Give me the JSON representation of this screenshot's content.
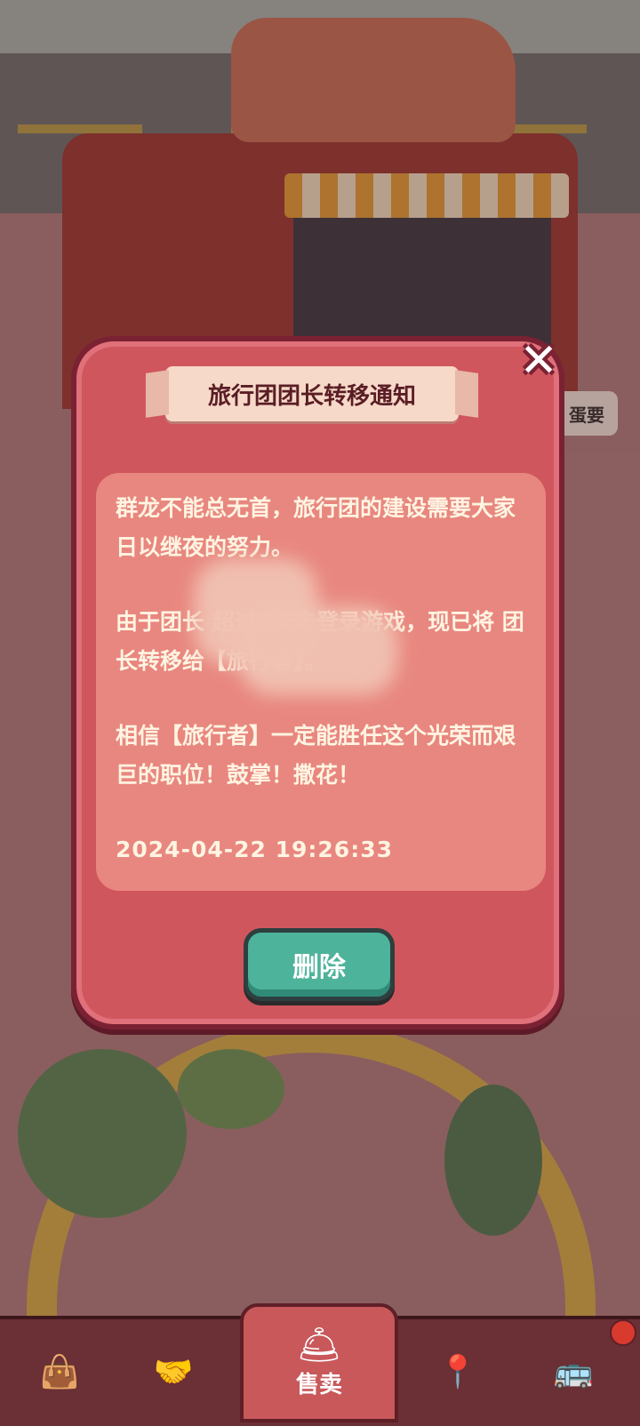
{
  "dialog": {
    "title": "旅行团团长转移通知",
    "paragraph1": "群龙不能总无首，旅行团的建设需要大家日以继夜的努力。",
    "paragraph2": "由于团长    超过7天未登录游戏，现已将     团长转移给【旅行者】。",
    "paragraph3": "相信【旅行者】一定能胜任这个光荣而艰巨的职位！鼓掌！撒花！",
    "timestamp": "2024-04-22 19:26:33",
    "delete_label": "删除",
    "close_glyph": "✕"
  },
  "side_sign": "蛋要",
  "nav": {
    "center_label": "售卖",
    "items": [
      {
        "icon": "bag-icon",
        "glyph": "👜"
      },
      {
        "icon": "handshake-icon",
        "glyph": "🤝"
      },
      {
        "icon": "map-pin-icon",
        "glyph": "📍"
      },
      {
        "icon": "bus-icon",
        "glyph": "🚌"
      }
    ],
    "center_icon": "service-bell-icon",
    "center_glyph": "🛎"
  },
  "colors": {
    "dialog_bg": "#d0565e",
    "button_green": "#4db39a",
    "text_cream": "#fff4e2"
  }
}
